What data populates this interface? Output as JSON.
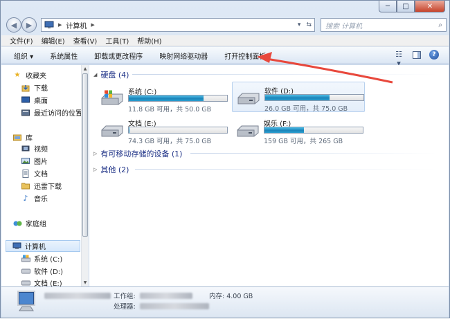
{
  "window": {
    "caption_buttons": {
      "minimize": "─",
      "maximize": "□",
      "close": "✕"
    }
  },
  "nav": {
    "back_glyph": "◀",
    "forward_glyph": "▶",
    "address_crumb": "计算机",
    "address_sep": "▶",
    "address_dropdown": "▾",
    "refresh_glyph": "⇆",
    "search_placeholder": "搜索 计算机",
    "search_glyph": "⌕"
  },
  "menubar": {
    "items": [
      "文件(F)",
      "编辑(E)",
      "查看(V)",
      "工具(T)",
      "帮助(H)"
    ]
  },
  "cmdbar": {
    "organize": "组织 ▾",
    "system_properties": "系统属性",
    "uninstall": "卸载或更改程序",
    "map_drive": "映射网络驱动器",
    "control_panel": "打开控制面板",
    "view_glyph": "☷ ▾"
  },
  "sidebar": {
    "favorites": "收藏夹",
    "downloads": "下载",
    "desktop": "桌面",
    "recent": "最近访问的位置",
    "libraries": "库",
    "videos": "视频",
    "pictures": "图片",
    "documents": "文档",
    "xunlei": "迅雷下载",
    "music": "音乐",
    "homegroup": "家庭组",
    "computer": "计算机",
    "drive_c": "系统 (C:)",
    "drive_d": "软件 (D:)",
    "drive_e": "文档 (E:)"
  },
  "groups": {
    "hdd": "硬盘 (4)",
    "removable": "有可移动存储的设备 (1)",
    "other": "其他 (2)"
  },
  "drives": [
    {
      "name": "系统 (C:)",
      "free": "11.8 GB 可用，共 50.0 GB",
      "used_fraction": 0.764
    },
    {
      "name": "软件 (D:)",
      "free": "26.0 GB 可用，共 75.0 GB",
      "used_fraction": 0.653
    },
    {
      "name": "文档 (E:)",
      "free": "74.3 GB 可用，共 75.0 GB",
      "used_fraction": 0.009
    },
    {
      "name": "娱乐 (F:)",
      "free": "159 GB 可用，共 265 GB",
      "used_fraction": 0.4
    }
  ],
  "details": {
    "workgroup_label": "工作组:",
    "cpu_label": "处理器:",
    "memory_label": "内存: 4.00 GB"
  },
  "colors": {
    "accent": "#1e3287",
    "drive_bar": "#1a83b9",
    "annotation_arrow": "#e8483c"
  }
}
